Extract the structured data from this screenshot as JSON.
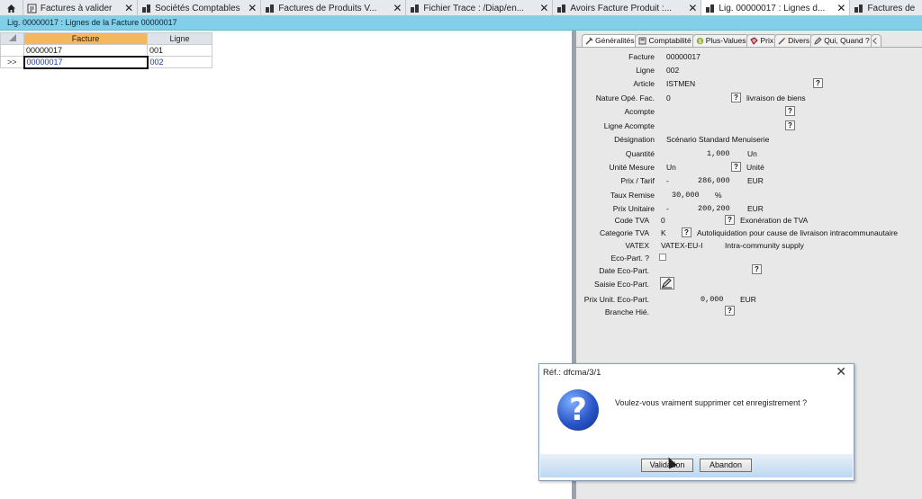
{
  "tabs": [
    {
      "label": "Factures à valider",
      "icon": "invoice-icon",
      "closable": true
    },
    {
      "label": "Sociétés Comptables",
      "icon": "company-icon",
      "closable": true
    },
    {
      "label": "Factures de Produits V...",
      "icon": "company-icon",
      "closable": true
    },
    {
      "label": "Fichier Trace : /Diap/en...",
      "icon": "company-icon",
      "closable": true
    },
    {
      "label": "Avoirs Facture Produit :...",
      "icon": "company-icon",
      "closable": true
    },
    {
      "label": "Lig. 00000017 : Lignes d...",
      "icon": "company-icon",
      "closable": true
    },
    {
      "label": "Factures de",
      "icon": "company-icon",
      "closable": false
    }
  ],
  "subheader": "Lig. 00000017 : Lignes de la Facture 00000017",
  "grid": {
    "columns": [
      "Facture",
      "Ligne"
    ],
    "rows": [
      {
        "marker": "",
        "facture": "00000017",
        "ligne": "001"
      },
      {
        "marker": ">>",
        "facture": "00000017",
        "ligne": "002"
      }
    ]
  },
  "subtabs": [
    "Généralités",
    "Comptabilité",
    "Plus-Values",
    "Prix",
    "Divers",
    "Qui, Quand ?"
  ],
  "form": {
    "facture": {
      "label": "Facture",
      "value": "00000017"
    },
    "ligne": {
      "label": "Ligne",
      "value": "002"
    },
    "article": {
      "label": "Article",
      "value": "ISTMEN"
    },
    "nature": {
      "label": "Nature Opé. Fac.",
      "value": "0",
      "desc": "livraison de biens"
    },
    "acompte": {
      "label": "Acompte"
    },
    "ligne_acompte": {
      "label": "Ligne Acompte"
    },
    "designation": {
      "label": "Désignation",
      "value": "Scénario Standard Menuiserie"
    },
    "quantite": {
      "label": "Quantité",
      "value": "1,000",
      "unit": "Un"
    },
    "unite": {
      "label": "Unité Mesure",
      "value": "Un",
      "desc": "Unité"
    },
    "prix_tarif": {
      "label": "Prix / Tarif",
      "sign": "-",
      "value": "286,000",
      "unit": "EUR"
    },
    "taux_remise": {
      "label": "Taux Remise",
      "value": "30,000",
      "unit": "%"
    },
    "prix_unitaire": {
      "label": "Prix Unitaire",
      "sign": "-",
      "value": "200,200",
      "unit": "EUR"
    },
    "code_tva": {
      "label": "Code TVA",
      "value": "0",
      "desc": "Exonération de TVA"
    },
    "categorie_tva": {
      "label": "Categorie TVA",
      "value": "K",
      "desc": "Autoliquidation pour cause de livraison intracommunautaire"
    },
    "vatex": {
      "label": "VATEX",
      "value": "VATEX-EU-I",
      "desc": "Intra-community supply"
    },
    "eco_part": {
      "label": "Eco-Part. ?"
    },
    "date_eco": {
      "label": "Date Eco-Part."
    },
    "saisie_eco": {
      "label": "Saisie Eco-Part."
    },
    "prix_unit_eco": {
      "label": "Prix Unit. Eco-Part.",
      "value": "0,000",
      "unit": "EUR"
    },
    "branche": {
      "label": "Branche Hié."
    }
  },
  "help_glyph": "?",
  "dialog": {
    "title": "Réf.: dfcma/3/1",
    "close": "✕",
    "icon_glyph": "?",
    "message": "Voulez-vous vraiment supprimer cet enregistrement ?",
    "validate_label": "Validation",
    "cancel_label": "Abandon"
  }
}
